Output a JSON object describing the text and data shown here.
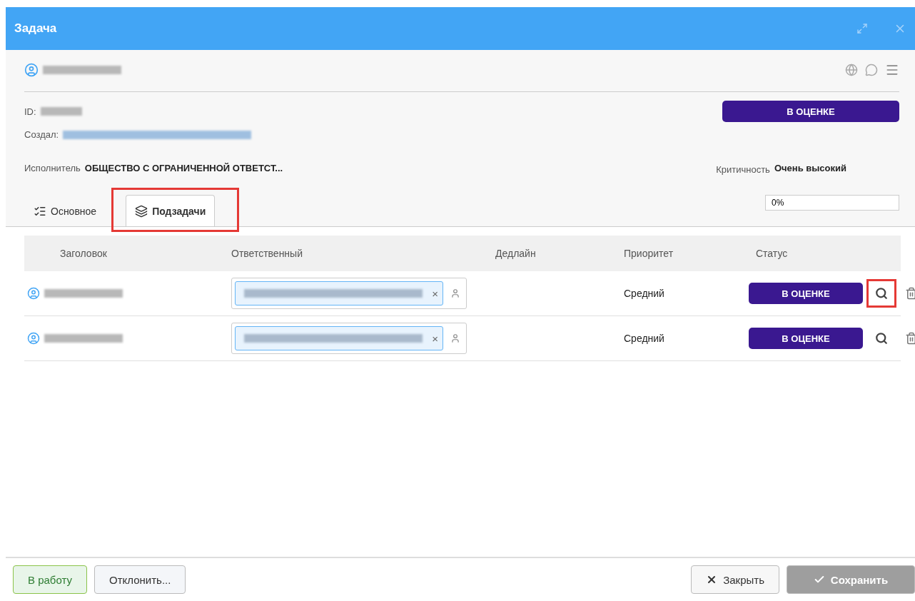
{
  "window": {
    "title": "Задача"
  },
  "header": {
    "id_label": "ID:",
    "creator_label": "Создал:",
    "status": "В ОЦЕНКЕ",
    "assignee_label": "Исполнитель",
    "assignee": "ОБЩЕСТВО С ОГРАНИЧЕННОЙ ОТВЕТСТ...",
    "criticality_label": "Критичность",
    "criticality": "Очень высокий"
  },
  "tabs": [
    {
      "label": "Основное",
      "selected": false,
      "highlighted": false
    },
    {
      "label": "Подзадачи",
      "selected": true,
      "highlighted": true
    }
  ],
  "progress": {
    "reading": "0%",
    "level": 0
  },
  "table": {
    "columns": [
      "Заголовок",
      "Ответственный",
      "Дедлайн",
      "Приоритет",
      "Статус"
    ],
    "rows": [
      {
        "remove": "×",
        "priority": "Средний",
        "status": "В ОЦЕНКЕ",
        "view_highlighted": true
      },
      {
        "remove": "×",
        "priority": "Средний",
        "status": "В ОЦЕНКЕ",
        "view_highlighted": false
      }
    ]
  },
  "footer": {
    "buttons": [
      {
        "label": "В работу",
        "kind": "accept",
        "disabled": false
      },
      {
        "label": "Отклонить...",
        "kind": "plain",
        "disabled": false
      },
      {
        "label": "Закрыть",
        "kind": "close",
        "disabled": false
      },
      {
        "label": "Сохранить",
        "kind": "save",
        "disabled": true
      }
    ]
  }
}
